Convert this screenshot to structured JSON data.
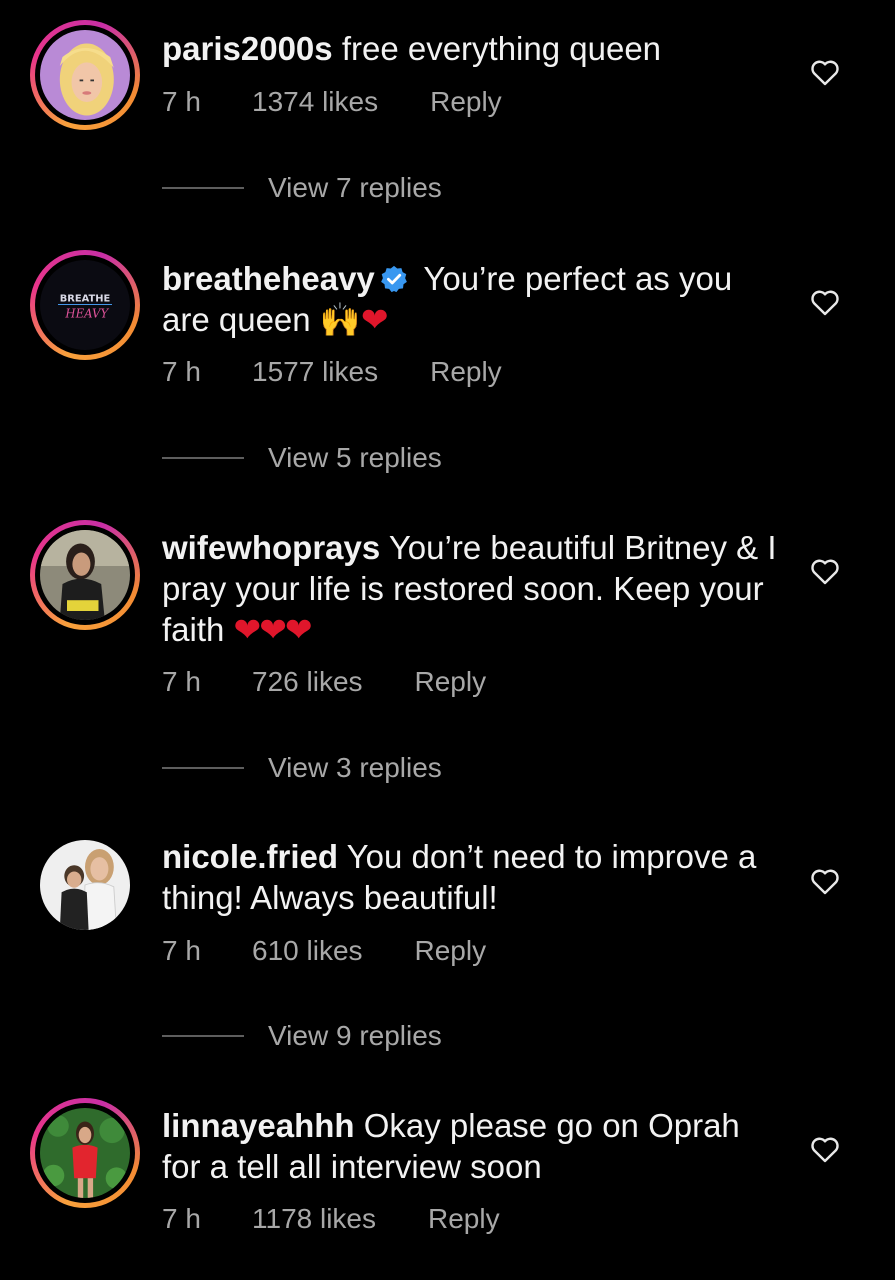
{
  "colors": {
    "background": "#000000",
    "text": "#f2f2f2",
    "muted": "#a8a8a8",
    "heart": "#e0162b",
    "verified": "#3897f0"
  },
  "comments": [
    {
      "username": "paris2000s",
      "text": "free everything queen",
      "time": "7 h",
      "likes": "1374 likes",
      "reply": "Reply",
      "view_replies": "View 7 replies",
      "verified": false,
      "story_ring": true
    },
    {
      "username": "breatheheavy",
      "text": "You’re perfect as you are queen",
      "emoji": "🙌",
      "hearts": "❤",
      "time": "7 h",
      "likes": "1577 likes",
      "reply": "Reply",
      "view_replies": "View 5 replies",
      "verified": true,
      "story_ring": true,
      "avatar_logo_top": "BREATHE",
      "avatar_logo_bottom": "HEAVY"
    },
    {
      "username": "wifewhoprays",
      "text": "You’re beautiful Britney & I pray your life is restored soon. Keep your faith",
      "hearts": "❤❤❤",
      "time": "7 h",
      "likes": "726 likes",
      "reply": "Reply",
      "view_replies": "View 3 replies",
      "verified": false,
      "story_ring": true
    },
    {
      "username": "nicole.fried",
      "text": "You don’t need to improve a thing! Always beautiful!",
      "time": "7 h",
      "likes": "610 likes",
      "reply": "Reply",
      "view_replies": "View 9 replies",
      "verified": false,
      "story_ring": false
    },
    {
      "username": "linnayeahhh",
      "text": "Okay please go on Oprah for a tell all interview soon",
      "time": "7 h",
      "likes": "1178 likes",
      "reply": "Reply",
      "verified": false,
      "story_ring": true
    }
  ],
  "icons": {
    "like": "heart-outline-icon",
    "verified": "verified-badge-icon"
  }
}
